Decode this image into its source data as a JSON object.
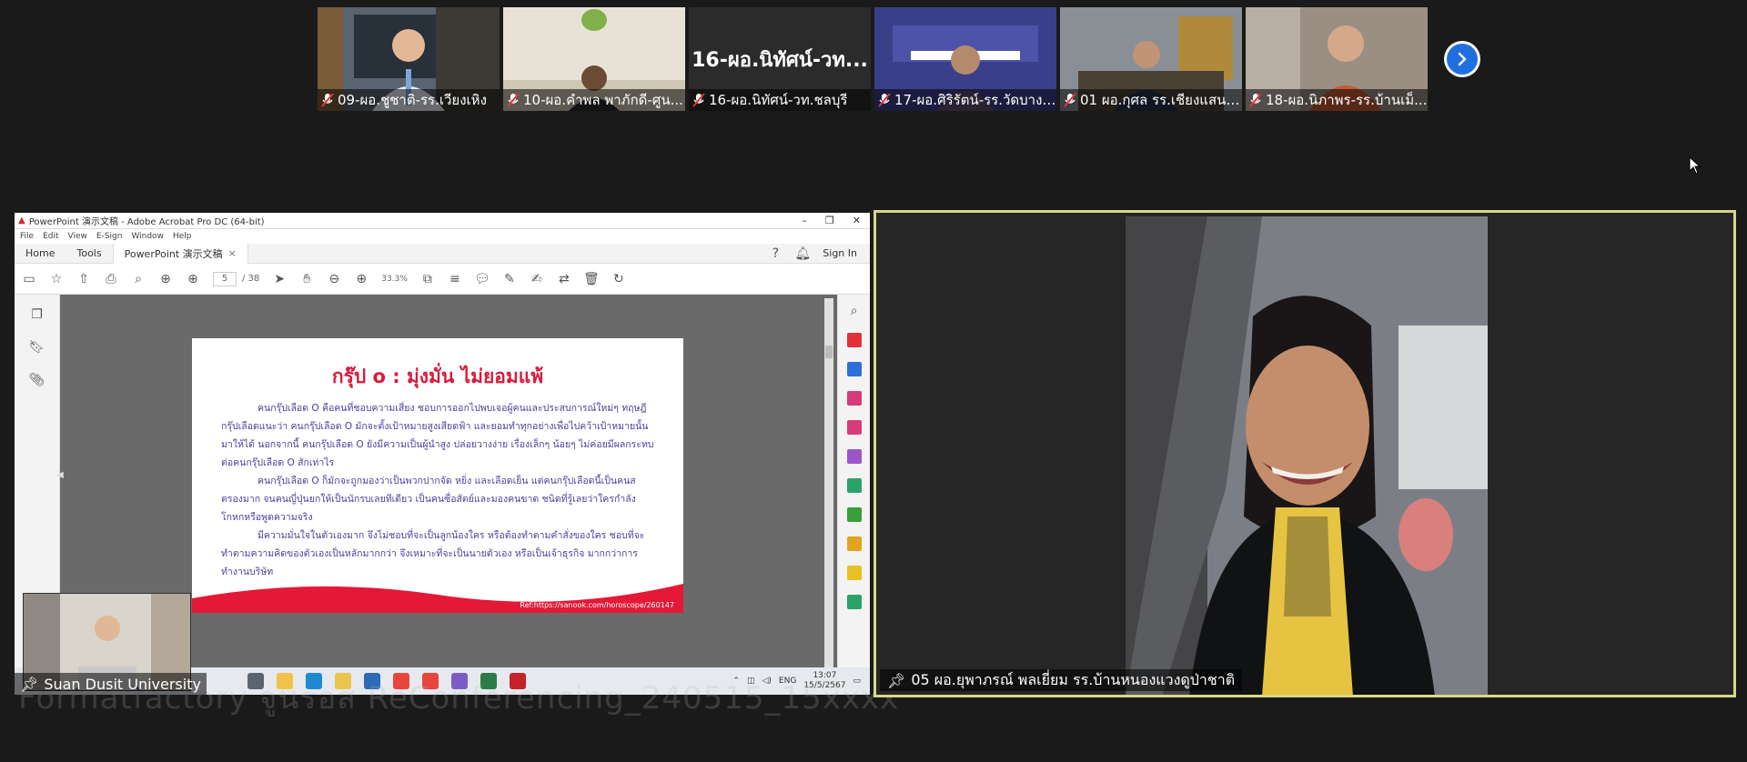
{
  "gallery": {
    "participants": [
      {
        "name": "09-ผอ.ชูชาติ-รร.เวียงเหิง",
        "muted": true
      },
      {
        "name": "10-ผอ.คำพล พาภักดี-ศูน...",
        "muted": true
      },
      {
        "name": "16-ผอ.นิทัศน์-วท.ชลบุรี",
        "muted": true,
        "video_text": "16-ผอ.นิทัศน์-วท..."
      },
      {
        "name": "17-ผอ.ศิริรัตน์-รร.วัดบางปิ...",
        "muted": true
      },
      {
        "name": "01 ผอ.กุศล รร.เชียงแสนวิ...",
        "muted": true
      },
      {
        "name": "18-ผอ.นิภาพร-รร.บ้านเม็...",
        "muted": true
      }
    ],
    "next_icon": "chevron-right-icon"
  },
  "share": {
    "caption": "Suan Dusit University",
    "watermark": "Formatfactory จูนรอส ReConferencing_240515_15xxxx",
    "acrobat": {
      "window_title": "PowerPoint 演示文稿 - Adobe Acrobat Pro DC (64-bit)",
      "menu": [
        "File",
        "Edit",
        "View",
        "E-Sign",
        "Window",
        "Help"
      ],
      "tabs": {
        "home": "Home",
        "tools": "Tools",
        "doc": "PowerPoint 演示文稿"
      },
      "sign_in": "Sign In",
      "page_current": "5",
      "page_total": "/ 38",
      "zoom": "33.3%"
    },
    "slide": {
      "title": "กรุ๊ป o : มุ่งมั่น ไม่ยอมแพ้",
      "paragraphs": [
        "คนกรุ๊ปเลือด O คือคนที่ชอบความเสี่ยง ชอบการออกไปพบเจอผู้คนและประสบการณ์ใหม่ๆ ทฤษฎีกรุ๊ปเลือดแนะว่า คนกรุ๊ปเลือด O มักจะตั้งเป้าหมายสูงเสียดฟ้า และยอมทำทุกอย่างเพื่อไปคว้าเป้าหมายนั้นมาให้ได้ นอกจากนี้ คนกรุ๊ปเลือด O ยังมีความเป็นผู้นำสูง ปล่อยวางง่าย เรื่องเล็กๆ น้อยๆ ไม่ค่อยมีผลกระทบต่อคนกรุ๊ปเลือด O สักเท่าไร",
        "คนกรุ๊ปเลือด O ก็มักจะถูกมองว่าเป็นพวกปากจัด หยิ่ง และเลือดเย็น แต่คนกรุ๊ปเลือดนี้เป็นคนสตรองมาก จนคนญี่ปุ่นยกให้เป็นนักรบเลยทีเดียว เป็นคนซื่อสัตย์และมองคนขาด ชนิดที่รู้เลยว่าใครกำลังโกหกหรือพูดความจริง",
        "มีความมั่นใจในตัวเองมาก จึงไม่ชอบที่จะเป็นลูกน้องใคร หรือต้องทำตามคำสั่งของใคร ชอบที่จะทำตามความคิดของตัวเองเป็นหลักมากกว่า จึงเหมาะที่จะเป็นนายตัวเอง หรือเป็นเจ้าธุรกิจ มากกว่าการทำงานบริษัท"
      ],
      "source": "Ref:https://sanook.com/horoscope/260147"
    },
    "taskbar": {
      "lang": "ENG",
      "time": "13:07",
      "date": "15/5/2567"
    }
  },
  "speaker": {
    "caption": "05 ผอ.ยุพาภรณ์ พลเยี่ยม รร.บ้านหนองแวงดูป่าชาติ"
  },
  "colors": {
    "background": "#1a1a1a",
    "active_border": "#d7d88a",
    "mute_red": "#e0343c",
    "next_blue": "#1f6fe0",
    "slide_title": "#d81b3c",
    "slide_text": "#4b3f9e"
  }
}
